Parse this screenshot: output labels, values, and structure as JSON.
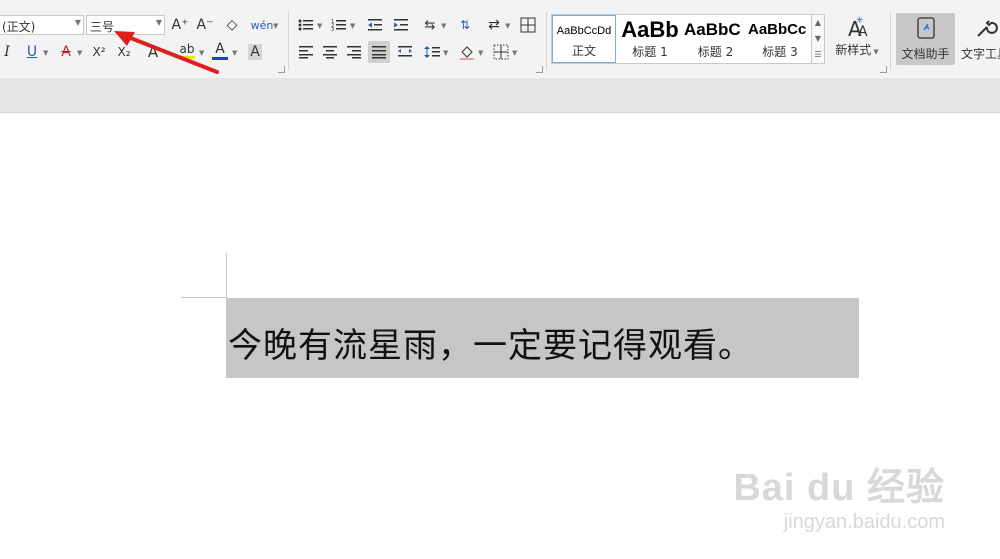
{
  "font": {
    "family_value": "(正文)",
    "size_value": "三号"
  },
  "icons": {
    "grow_font": "A⁺",
    "shrink_font": "A⁻",
    "clear_format": "◇",
    "phonetic": "wén",
    "italic": "I",
    "underline": "U",
    "strike": "A",
    "superscript": "X²",
    "subscript": "X₂",
    "text_effect": "A",
    "highlight": "ab",
    "font_color": "A",
    "char_shading": "A"
  },
  "styles": {
    "items": [
      {
        "preview": "AaBbCcDd",
        "label": "正文"
      },
      {
        "preview": "AaBb",
        "label": "标题 1"
      },
      {
        "preview": "AaBbC",
        "label": "标题 2"
      },
      {
        "preview": "AaBbCc",
        "label": "标题 3"
      }
    ],
    "new_style_label": "新样式"
  },
  "toolbar": {
    "doc_assistant": "文档助手",
    "text_tools": "文字工具"
  },
  "document": {
    "text": "今晚有流星雨，一定要记得观看。"
  },
  "watermark": {
    "brand": "Bai du 经验",
    "url": "jingyan.baidu.com"
  },
  "colors": {
    "annotation_arrow": "#e02020",
    "font_color_bar": "#1f3fd0",
    "highlight_bar": "#f5e600"
  }
}
